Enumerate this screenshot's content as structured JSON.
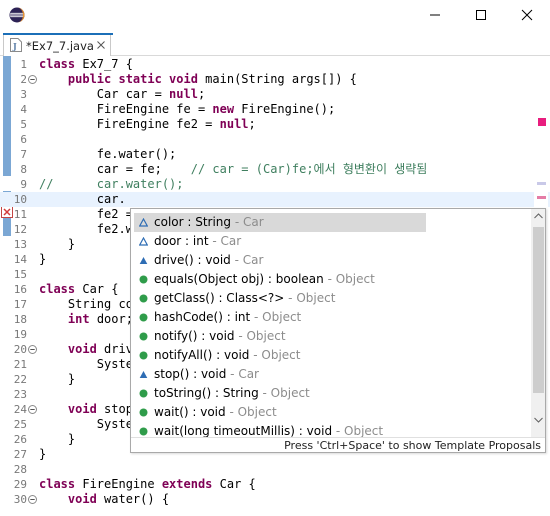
{
  "window": {
    "logo": "eclipse-logo-icon",
    "controls": [
      "minimize-icon",
      "maximize-icon",
      "close-icon"
    ]
  },
  "editor_tab": {
    "title": "*Ex7_7.java",
    "icon": "java-file-icon"
  },
  "lines": [
    {
      "n": "1",
      "fold": false,
      "tokens": [
        {
          "k": "kw",
          "t": "class"
        },
        {
          "k": "pl",
          "t": " Ex7_7 {"
        }
      ]
    },
    {
      "n": "2",
      "fold": true,
      "tokens": [
        {
          "k": "pl",
          "t": "    "
        },
        {
          "k": "kw",
          "t": "public static void"
        },
        {
          "k": "pl",
          "t": " main(String args[]) {"
        }
      ]
    },
    {
      "n": "3",
      "fold": false,
      "tokens": [
        {
          "k": "pl",
          "t": "        Car car = "
        },
        {
          "k": "kw",
          "t": "null"
        },
        {
          "k": "pl",
          "t": ";"
        }
      ]
    },
    {
      "n": "4",
      "fold": false,
      "tokens": [
        {
          "k": "pl",
          "t": "        FireEngine fe = "
        },
        {
          "k": "kw",
          "t": "new"
        },
        {
          "k": "pl",
          "t": " FireEngine();"
        }
      ]
    },
    {
      "n": "5",
      "fold": false,
      "tokens": [
        {
          "k": "pl",
          "t": "        FireEngine fe2 = "
        },
        {
          "k": "kw",
          "t": "null"
        },
        {
          "k": "pl",
          "t": ";"
        }
      ]
    },
    {
      "n": "6",
      "fold": false,
      "tokens": []
    },
    {
      "n": "7",
      "fold": false,
      "tokens": [
        {
          "k": "pl",
          "t": "        fe.water();"
        }
      ]
    },
    {
      "n": "8",
      "fold": false,
      "tokens": [
        {
          "k": "pl",
          "t": "        car = fe;    "
        },
        {
          "k": "cm",
          "t": "// car = (Car)fe;에서 형변환이 생략됨"
        }
      ]
    },
    {
      "n": "9",
      "fold": false,
      "tokens": [
        {
          "k": "cm",
          "t": "//      car.water();"
        }
      ]
    },
    {
      "n": "10",
      "fold": false,
      "tokens": [
        {
          "k": "pl",
          "t": "        car."
        }
      ]
    },
    {
      "n": "11",
      "fold": false,
      "tokens": [
        {
          "k": "pl",
          "t": "        fe2 = "
        }
      ]
    },
    {
      "n": "12",
      "fold": false,
      "tokens": [
        {
          "k": "pl",
          "t": "        fe2.w"
        }
      ]
    },
    {
      "n": "13",
      "fold": false,
      "tokens": [
        {
          "k": "pl",
          "t": "    }"
        }
      ]
    },
    {
      "n": "14",
      "fold": false,
      "tokens": [
        {
          "k": "pl",
          "t": "}"
        }
      ]
    },
    {
      "n": "15",
      "fold": false,
      "tokens": []
    },
    {
      "n": "16",
      "fold": false,
      "tokens": [
        {
          "k": "kw",
          "t": "class"
        },
        {
          "k": "pl",
          "t": " Car {"
        }
      ]
    },
    {
      "n": "17",
      "fold": false,
      "tokens": [
        {
          "k": "pl",
          "t": "    String co"
        }
      ]
    },
    {
      "n": "18",
      "fold": false,
      "tokens": [
        {
          "k": "pl",
          "t": "    "
        },
        {
          "k": "kw",
          "t": "int"
        },
        {
          "k": "pl",
          "t": " door;"
        }
      ]
    },
    {
      "n": "19",
      "fold": false,
      "tokens": []
    },
    {
      "n": "20",
      "fold": true,
      "tokens": [
        {
          "k": "pl",
          "t": "    "
        },
        {
          "k": "kw",
          "t": "void"
        },
        {
          "k": "pl",
          "t": " drive"
        }
      ]
    },
    {
      "n": "21",
      "fold": false,
      "tokens": [
        {
          "k": "pl",
          "t": "        Syste"
        }
      ]
    },
    {
      "n": "22",
      "fold": false,
      "tokens": [
        {
          "k": "pl",
          "t": "    }"
        }
      ]
    },
    {
      "n": "23",
      "fold": false,
      "tokens": []
    },
    {
      "n": "24",
      "fold": true,
      "tokens": [
        {
          "k": "pl",
          "t": "    "
        },
        {
          "k": "kw",
          "t": "void"
        },
        {
          "k": "pl",
          "t": " stop"
        }
      ]
    },
    {
      "n": "25",
      "fold": false,
      "tokens": [
        {
          "k": "pl",
          "t": "        Syste"
        }
      ]
    },
    {
      "n": "26",
      "fold": false,
      "tokens": [
        {
          "k": "pl",
          "t": "    }"
        }
      ]
    },
    {
      "n": "27",
      "fold": false,
      "tokens": [
        {
          "k": "pl",
          "t": "}"
        }
      ]
    },
    {
      "n": "28",
      "fold": false,
      "tokens": []
    },
    {
      "n": "29",
      "fold": false,
      "tokens": [
        {
          "k": "kw",
          "t": "class"
        },
        {
          "k": "pl",
          "t": " FireEngine "
        },
        {
          "k": "kw",
          "t": "extends"
        },
        {
          "k": "pl",
          "t": " Car {"
        }
      ]
    },
    {
      "n": "30",
      "fold": true,
      "tokens": [
        {
          "k": "pl",
          "t": "    "
        },
        {
          "k": "kw",
          "t": "void"
        },
        {
          "k": "pl",
          "t": " water() {"
        }
      ]
    }
  ],
  "current_line": "10",
  "content_assist": {
    "proposals": [
      {
        "icon": "field-default-icon",
        "label": "color : String",
        "owner": " - Car",
        "selected": true
      },
      {
        "icon": "field-default-icon",
        "label": "door : int",
        "owner": " - Car",
        "selected": false
      },
      {
        "icon": "method-default-icon",
        "label": "drive() : void",
        "owner": " - Car",
        "selected": false
      },
      {
        "icon": "method-public-icon",
        "label": "equals(Object obj) : boolean",
        "owner": " - Object",
        "selected": false
      },
      {
        "icon": "method-public-icon",
        "label": "getClass() : Class<?>",
        "owner": " - Object",
        "selected": false
      },
      {
        "icon": "method-public-icon",
        "label": "hashCode() : int",
        "owner": " - Object",
        "selected": false
      },
      {
        "icon": "method-public-icon",
        "label": "notify() : void",
        "owner": " - Object",
        "selected": false
      },
      {
        "icon": "method-public-icon",
        "label": "notifyAll() : void",
        "owner": " - Object",
        "selected": false
      },
      {
        "icon": "method-default-icon",
        "label": "stop() : void",
        "owner": " - Car",
        "selected": false
      },
      {
        "icon": "method-public-icon",
        "label": "toString() : String",
        "owner": " - Object",
        "selected": false
      },
      {
        "icon": "method-public-icon",
        "label": "wait() : void",
        "owner": " - Object",
        "selected": false
      },
      {
        "icon": "method-public-icon",
        "label": "wait(long timeoutMillis) : void",
        "owner": " - Object",
        "selected": false
      }
    ],
    "hint": "Press 'Ctrl+Space' to show Template Proposals"
  },
  "colors": {
    "keyword": "#7f0055",
    "comment": "#3f7f5f",
    "line_number": "#787878",
    "current_line": "#e8f2fe",
    "public_method": "#2f9c4a",
    "default_member": "#2e6db4",
    "selection": "#d9d9d9"
  }
}
